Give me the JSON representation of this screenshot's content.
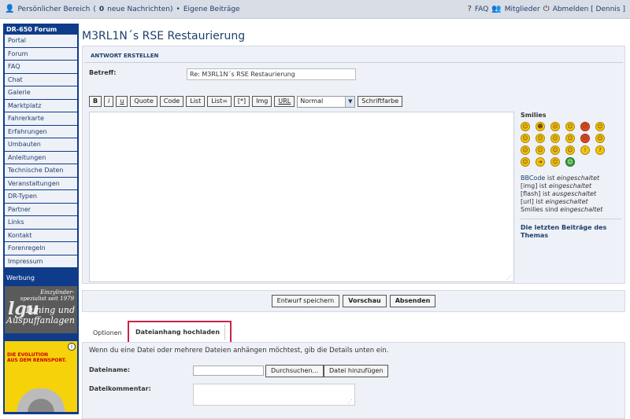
{
  "topbar": {
    "personal": "Persönlicher Bereich",
    "messages_open": "(",
    "messages_count": "0",
    "messages_text": "neue Nachrichten)",
    "separator": "•",
    "own_posts": "Eigene Beiträge",
    "faq": "FAQ",
    "members": "Mitglieder",
    "logout": "Abmelden [ Dennis ]"
  },
  "sidebar": {
    "header": "DR-650 Forum",
    "items": [
      "Portal",
      "Forum",
      "FAQ",
      "Chat",
      "Galerie",
      "Marktplatz",
      "Fahrerkarte",
      "Erfahrungen",
      "Umbauten",
      "Anleitungen",
      "Technische Daten",
      "Veranstaltungen",
      "DR-Typen",
      "Partner",
      "Links",
      "Kontakt",
      "Forenregeln",
      "Impressum"
    ],
    "werbung": "Werbung",
    "ad1_line1": "Einzylinder-",
    "ad1_line2": "spezialist seit 1979",
    "ad1_logo": "lgu",
    "ad1_line3": "Tuning und",
    "ad1_line4": "Auspuffanlagen",
    "ad2_line1": "DIE EVOLUTION",
    "ad2_line2": "AUS DEM RENNSPORT.",
    "ad2_info": "i"
  },
  "page": {
    "title": "M3RL1N´s RSE Restaurierung",
    "panel_head": "ANTWORT ERSTELLEN",
    "subject_label": "Betreff:",
    "subject_value": "Re: M3RL1N´s RSE Restaurierung"
  },
  "toolbar": {
    "bold": "B",
    "italic": "i",
    "underline": "u",
    "quote": "Quote",
    "code": "Code",
    "list": "List",
    "list_eq": "List=",
    "star": "[*]",
    "img": "Img",
    "url": "URL",
    "size_selected": "Normal",
    "color": "Schriftfarbe"
  },
  "smilies": {
    "title": "Smilies",
    "faces": [
      "☺",
      "☻",
      "☹",
      "☺",
      "☹",
      "☺",
      "☺",
      "☺",
      "☺",
      "☺",
      "☹",
      "☺",
      "☺",
      "☺",
      "☺",
      "☺",
      "!",
      "?",
      "☺",
      "➜",
      "☺",
      "☺"
    ],
    "bbcode_link": "BBCode",
    "bbcode_rest": "ist",
    "bbcode_state": "eingeschaltet",
    "img_line": "[img] ist",
    "img_state": "eingeschaltet",
    "flash_line": "[flash] ist",
    "flash_state": "ausgeschaltet",
    "url_line": "[url] ist",
    "url_state": "eingeschaltet",
    "smilies_line": "Smilies sind",
    "smilies_state": "eingeschaltet",
    "latest": "Die letzten Beiträge des Themas"
  },
  "actions": {
    "draft": "Entwurf speichern",
    "preview": "Vorschau",
    "submit": "Absenden"
  },
  "tabs": {
    "options": "Optionen",
    "attachment": "Dateianhang hochladen"
  },
  "attach": {
    "intro": "Wenn du eine Datei oder mehrere Dateien anhängen möchtest, gib die Details unten ein.",
    "filename_label": "Dateiname:",
    "browse": "Durchsuchen...",
    "add": "Datei hinzufügen",
    "comment_label": "Dateikommentar:"
  }
}
